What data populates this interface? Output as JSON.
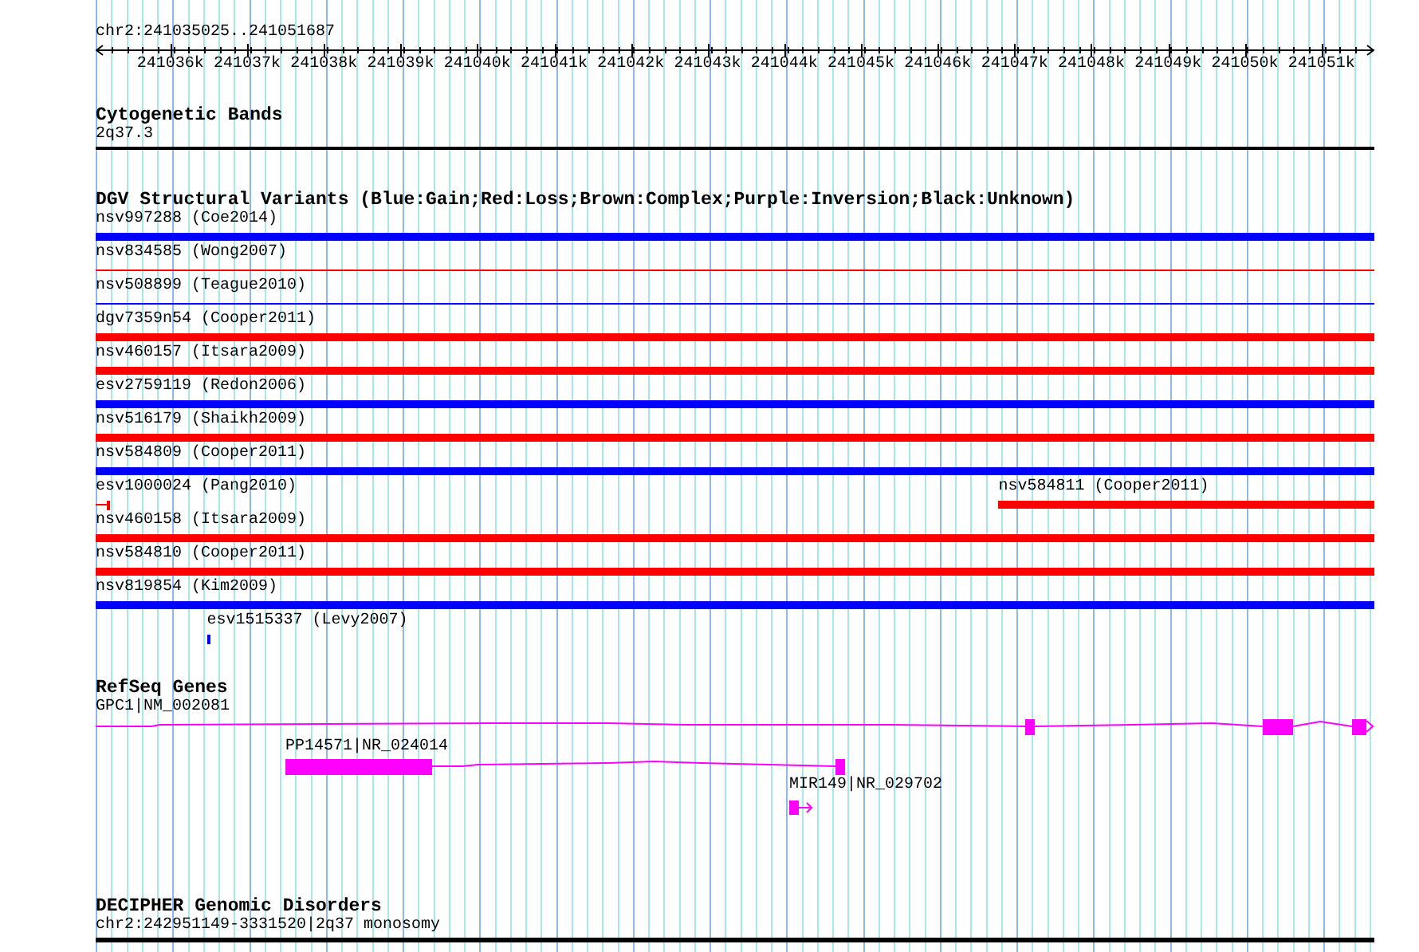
{
  "ruler": {
    "region": "chr2:241035025..241051687",
    "ticks": [
      "241036k",
      "241037k",
      "241038k",
      "241039k",
      "241040k",
      "241041k",
      "241042k",
      "241043k",
      "241044k",
      "241045k",
      "241046k",
      "241047k",
      "241048k",
      "241049k",
      "241050k",
      "241051k"
    ]
  },
  "tracks": [
    {
      "kind": "cytoband",
      "title": "Cytogenetic Bands",
      "features": [
        {
          "label": "2q37.3"
        }
      ]
    },
    {
      "kind": "variants",
      "title": "DGV Structural Variants (Blue:Gain;Red:Loss;Brown:Complex;Purple:Inversion;Black:Unknown)",
      "rows": [
        {
          "features": [
            {
              "label": "nsv997288 (Coe2014)",
              "kind": "bar",
              "color": "#0000ff"
            }
          ]
        },
        {
          "features": [
            {
              "label": "nsv834585 (Wong2007)",
              "kind": "line",
              "color": "#ff0000"
            }
          ]
        },
        {
          "features": [
            {
              "label": "nsv508899 (Teague2010)",
              "kind": "line",
              "color": "#0000ff"
            }
          ]
        },
        {
          "features": [
            {
              "label": "dgv7359n54 (Cooper2011)",
              "kind": "bar",
              "color": "#ff0000"
            }
          ]
        },
        {
          "features": [
            {
              "label": "nsv460157 (Itsara2009)",
              "kind": "bar",
              "color": "#ff0000"
            }
          ]
        },
        {
          "features": [
            {
              "label": "esv2759119 (Redon2006)",
              "kind": "bar",
              "color": "#0000ff"
            }
          ]
        },
        {
          "features": [
            {
              "label": "nsv516179 (Shaikh2009)",
              "kind": "bar",
              "color": "#ff0000"
            }
          ]
        },
        {
          "features": [
            {
              "label": "nsv584809 (Cooper2011)",
              "kind": "bar",
              "color": "#0000ff"
            }
          ]
        },
        {
          "features": [
            {
              "label": "esv1000024 (Pang2010)",
              "kind": "stub",
              "color": "#ff0000"
            },
            {
              "label": "nsv584811 (Cooper2011)",
              "kind": "bar",
              "color": "#ff0000"
            }
          ]
        },
        {
          "features": [
            {
              "label": "nsv460158 (Itsara2009)",
              "kind": "bar",
              "color": "#ff0000"
            }
          ]
        },
        {
          "features": [
            {
              "label": "nsv584810 (Cooper2011)",
              "kind": "bar",
              "color": "#ff0000"
            }
          ]
        },
        {
          "features": [
            {
              "label": "nsv819854 (Kim2009)",
              "kind": "bar",
              "color": "#0000ff"
            }
          ]
        },
        {
          "features": [
            {
              "label": "esv1515337 (Levy2007)",
              "kind": "mark",
              "color": "#0000ff"
            }
          ]
        }
      ]
    },
    {
      "kind": "genes",
      "title": "RefSeq Genes",
      "features": [
        {
          "label": "GPC1|NM_002081"
        },
        {
          "label": "PP14571|NR_024014"
        },
        {
          "label": "MIR149|NR_029702"
        }
      ]
    },
    {
      "kind": "disorders",
      "title": "DECIPHER Genomic Disorders",
      "features": [
        {
          "label": "chr2:242951149-3331520|2q37 monosomy"
        }
      ]
    }
  ]
}
